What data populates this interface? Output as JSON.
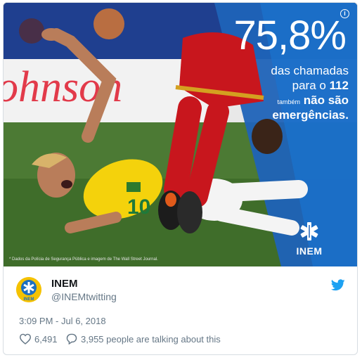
{
  "media": {
    "stat_number": "75,8%",
    "line1": "das chamadas",
    "line2_prefix": "para o",
    "line2_number": "112",
    "line3_small": "também",
    "line3_bold": "não são",
    "line4": "emergências.",
    "logo_text": "INEM",
    "credit": "* Dados da Polícia de Segurança Pública e imagem de The Wall Street Journal.",
    "info_glyph": "i"
  },
  "tweet": {
    "display_name": "INEM",
    "handle": "@INEMtwitting",
    "timestamp": "3:09 PM - Jul 6, 2018",
    "likes": "6,491",
    "talking": "3,955 people are talking about this",
    "avatar_text": "INEM"
  },
  "colors": {
    "inem_blue": "#1b6fc0",
    "twitter_blue": "#1da1f2",
    "jersey_yellow": "#f4d20c",
    "jersey_red": "#c8161d"
  },
  "icons": {
    "info": "info-icon",
    "star_of_life": "star-of-life-icon",
    "twitter": "twitter-bird-icon",
    "like": "heart-icon",
    "reply": "speech-bubble-icon"
  }
}
